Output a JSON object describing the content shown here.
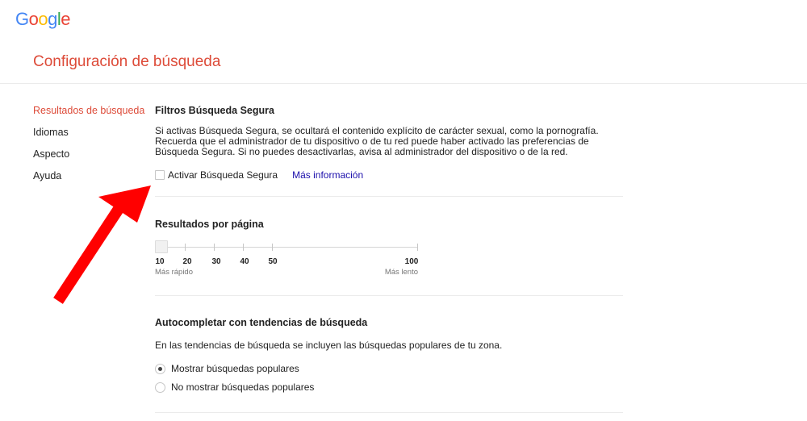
{
  "logo": {
    "letters": [
      "G",
      "o",
      "o",
      "g",
      "l",
      "e"
    ],
    "colors": [
      "#4285f4",
      "#ea4335",
      "#fbbc05",
      "#4285f4",
      "#34a853",
      "#ea4335"
    ]
  },
  "header": {
    "title": "Configuración de búsqueda"
  },
  "sidebar": {
    "items": [
      {
        "label": "Resultados de búsqueda",
        "active": true
      },
      {
        "label": "Idiomas",
        "active": false
      },
      {
        "label": "Aspecto",
        "active": false
      },
      {
        "label": "Ayuda",
        "active": false
      }
    ]
  },
  "safe_search": {
    "title": "Filtros Búsqueda Segura",
    "description": "Si activas Búsqueda Segura, se ocultará el contenido explícito de carácter sexual, como la pornografía. Recuerda que el administrador de tu dispositivo o de tu red puede haber activado las preferencias de Búsqueda Segura. Si no puedes desactivarlas, avisa al administrador del dispositivo o de la red.",
    "checkbox_label": "Activar Búsqueda Segura",
    "checked": false,
    "more_info": "Más información"
  },
  "results_per_page": {
    "title": "Resultados por página",
    "ticks": [
      "10",
      "20",
      "30",
      "40",
      "50",
      "100"
    ],
    "selected": "10",
    "fast_label": "Más rápido",
    "slow_label": "Más lento"
  },
  "autocomplete": {
    "title": "Autocompletar con tendencias de búsqueda",
    "description": "En las tendencias de búsqueda se incluyen las búsquedas populares de tu zona.",
    "options": [
      {
        "label": "Mostrar búsquedas populares",
        "checked": true
      },
      {
        "label": "No mostrar búsquedas populares",
        "checked": false
      }
    ]
  },
  "colors": {
    "accent_red": "#dd4b39",
    "link_blue": "#1a0dab",
    "arrow_red": "#ff0000"
  }
}
